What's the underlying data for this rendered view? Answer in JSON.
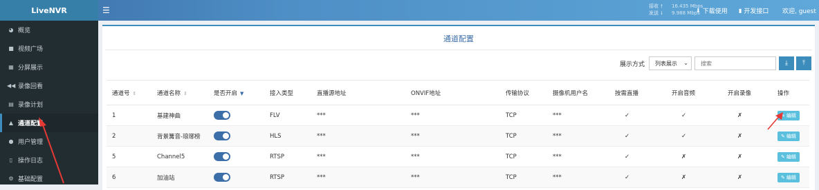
{
  "app": {
    "brand": "LiveNVR"
  },
  "topbar": {
    "net_rx_label": "接收",
    "net_rx_value": "16.435 Mbps",
    "net_tx_label": "发送",
    "net_tx_value": "9.988 Mbps",
    "download_label": "下载使用",
    "api_label": "开发接口",
    "welcome": "欢迎, guest"
  },
  "sidebar": {
    "items": [
      {
        "label": "概览",
        "icon": "dashboard-icon"
      },
      {
        "label": "视频广场",
        "icon": "video-icon"
      },
      {
        "label": "分屏展示",
        "icon": "grid-icon"
      },
      {
        "label": "录像回看",
        "icon": "rewind-icon"
      },
      {
        "label": "录像计划",
        "icon": "calendar-icon"
      },
      {
        "label": "通道配置",
        "icon": "channel-icon",
        "active": true
      },
      {
        "label": "用户管理",
        "icon": "users-icon"
      },
      {
        "label": "操作日志",
        "icon": "file-icon"
      },
      {
        "label": "基础配置",
        "icon": "cogs-icon"
      }
    ]
  },
  "panel": {
    "title": "通道配置",
    "display_mode_label": "展示方式",
    "display_mode_value": "列表展示",
    "search_placeholder": "搜索"
  },
  "table": {
    "headers": [
      "通道号",
      "通道名称",
      "是否开启",
      "接入类型",
      "直播源地址",
      "ONVIF地址",
      "传输协议",
      "摄像机用户名",
      "按需直播",
      "开启音频",
      "开启录像",
      "操作"
    ],
    "rows": [
      {
        "id": "1",
        "name": "基建神曲",
        "type": "FLV",
        "source": "***",
        "onvif": "***",
        "protocol": "TCP",
        "user": "***",
        "on_demand": "✓",
        "audio": "✓",
        "record": "✗",
        "action": "编辑"
      },
      {
        "id": "2",
        "name": "背景篝音-琅琊榜",
        "type": "HLS",
        "source": "***",
        "onvif": "***",
        "protocol": "TCP",
        "user": "***",
        "on_demand": "✓",
        "audio": "✓",
        "record": "✗",
        "action": "编辑"
      },
      {
        "id": "5",
        "name": "Channel5",
        "type": "RTSP",
        "source": "***",
        "onvif": "***",
        "protocol": "TCP",
        "user": "***",
        "on_demand": "✓",
        "audio": "✗",
        "record": "✗",
        "action": "编辑"
      },
      {
        "id": "6",
        "name": "加油站",
        "type": "RTSP",
        "source": "***",
        "onvif": "***",
        "protocol": "TCP",
        "user": "***",
        "on_demand": "✓",
        "audio": "✗",
        "record": "✗",
        "action": "编辑"
      }
    ]
  },
  "colors": {
    "accent": "#3c8dbc",
    "sidebar": "#222d32",
    "annotation": "#e53935"
  }
}
